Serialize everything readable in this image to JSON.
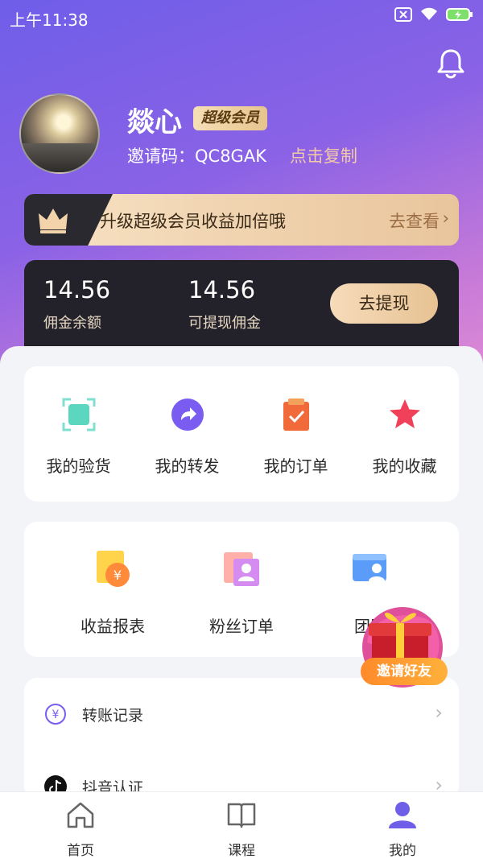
{
  "status_bar": {
    "time": "上午11:38"
  },
  "profile": {
    "nickname": "燚心",
    "vip_badge": "超级会员",
    "invite_code_label": "邀请码：QC8GAK",
    "copy_label": "点击复制"
  },
  "upgrade_banner": {
    "text": "升级超级会员收益加倍哦",
    "action": "去查看",
    "arrow": "›"
  },
  "wallet": {
    "balance_value": "14.56",
    "balance_label": "佣金余额",
    "withdrawable_value": "14.56",
    "withdrawable_label": "可提现佣金",
    "withdraw_button": "去提现"
  },
  "quick_menu": [
    {
      "label": "我的验货",
      "icon": "inspect-icon",
      "color": "#5bd6bf"
    },
    {
      "label": "我的转发",
      "icon": "share-icon",
      "color": "#7b5cf0"
    },
    {
      "label": "我的订单",
      "icon": "order-icon",
      "color": "#f06a3a"
    },
    {
      "label": "我的收藏",
      "icon": "star-icon",
      "color": "#f0405a"
    }
  ],
  "tools_menu": [
    {
      "label": "收益报表",
      "icon": "earnings-report-icon"
    },
    {
      "label": "粉丝订单",
      "icon": "fans-order-icon"
    },
    {
      "label": "团队",
      "icon": "team-icon"
    }
  ],
  "floating_promo": {
    "label": "邀请好友",
    "icon": "gift-box-icon"
  },
  "list": [
    {
      "label": "转账记录",
      "icon": "transfer-icon",
      "arrow": "›"
    },
    {
      "label": "抖音认证",
      "icon": "douyin-icon",
      "arrow": "›"
    }
  ],
  "tabbar": [
    {
      "label": "首页",
      "icon": "home-icon",
      "active": false
    },
    {
      "label": "课程",
      "icon": "book-icon",
      "active": false
    },
    {
      "label": "我的",
      "icon": "user-icon",
      "active": true
    }
  ],
  "colors": {
    "accent": "#6f5ee8",
    "gold": "#e7c293",
    "dark_card": "#23222a"
  }
}
